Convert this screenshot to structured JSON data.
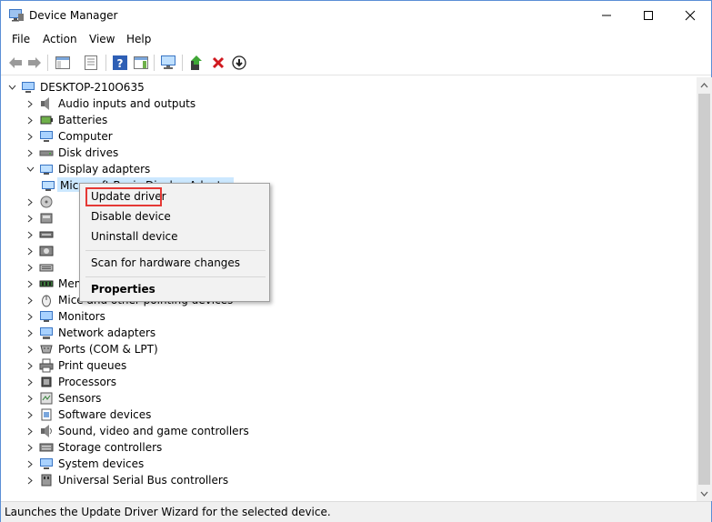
{
  "window": {
    "title": "Device Manager",
    "controls": {
      "minimize": "–",
      "maximize": "☐",
      "close": "✕"
    }
  },
  "menubar": {
    "items": [
      "File",
      "Action",
      "View",
      "Help"
    ]
  },
  "toolbar": {
    "buttons": [
      "back-icon",
      "forward-icon",
      "show-hide-console-tree-icon",
      "properties-icon",
      "help-icon",
      "action-pane-icon",
      "scan-hardware-icon",
      "update-driver-icon",
      "uninstall-icon",
      "disable-icon"
    ]
  },
  "tree": {
    "root": "DESKTOP-210O635",
    "items": [
      {
        "label": "Audio inputs and outputs",
        "icon": "speaker-icon"
      },
      {
        "label": "Batteries",
        "icon": "battery-icon"
      },
      {
        "label": "Computer",
        "icon": "computer-icon"
      },
      {
        "label": "Disk drives",
        "icon": "disk-icon"
      },
      {
        "label": "Display adapters",
        "icon": "display-icon",
        "expanded": true
      },
      {
        "label": "Microsoft Basic Display Adapter",
        "icon": "display-icon",
        "child": true,
        "selected": true
      },
      {
        "label": "",
        "icon": "dvd-icon"
      },
      {
        "label": "",
        "icon": "hid-icon"
      },
      {
        "label": "",
        "icon": "ide-icon"
      },
      {
        "label": "",
        "icon": "imaging-icon"
      },
      {
        "label": "",
        "icon": "keyboard-icon"
      },
      {
        "label": "Memory devices",
        "icon": "memory-icon"
      },
      {
        "label": "Mice and other pointing devices",
        "icon": "mouse-icon"
      },
      {
        "label": "Monitors",
        "icon": "monitor-icon"
      },
      {
        "label": "Network adapters",
        "icon": "network-icon"
      },
      {
        "label": "Ports (COM & LPT)",
        "icon": "port-icon"
      },
      {
        "label": "Print queues",
        "icon": "printer-icon"
      },
      {
        "label": "Processors",
        "icon": "processor-icon"
      },
      {
        "label": "Sensors",
        "icon": "sensor-icon"
      },
      {
        "label": "Software devices",
        "icon": "software-icon"
      },
      {
        "label": "Sound, video and game controllers",
        "icon": "sound-icon"
      },
      {
        "label": "Storage controllers",
        "icon": "storage-icon"
      },
      {
        "label": "System devices",
        "icon": "system-icon"
      },
      {
        "label": "Universal Serial Bus controllers",
        "icon": "usb-icon"
      }
    ]
  },
  "context_menu": {
    "items": [
      "Update driver",
      "Disable device",
      "Uninstall device",
      "Scan for hardware changes",
      "Properties"
    ],
    "highlight_color": "#e53935"
  },
  "statusbar": {
    "text": "Launches the Update Driver Wizard for the selected device."
  },
  "colors": {
    "selection": "#cce8ff",
    "border": "#5b8fd6"
  }
}
